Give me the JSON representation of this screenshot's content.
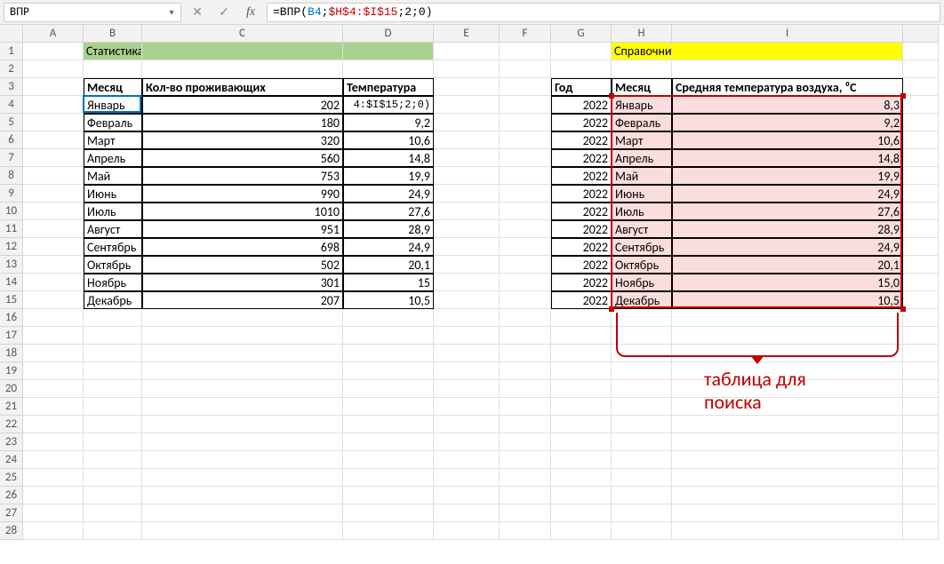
{
  "nameBox": "ВПР",
  "formula": {
    "prefix": "=ВПР(",
    "arg1": "B4",
    "sep1": ";",
    "arg2": "$H$4:$I$15",
    "sep2": ";",
    "arg3": "2",
    "sep3": ";",
    "arg4": "0",
    "suffix": ")"
  },
  "columns": [
    "A",
    "B",
    "C",
    "D",
    "E",
    "F",
    "G",
    "H",
    "I"
  ],
  "rows": [
    "1",
    "2",
    "3",
    "4",
    "5",
    "6",
    "7",
    "8",
    "9",
    "10",
    "11",
    "12",
    "13",
    "14",
    "15",
    "16",
    "17",
    "18",
    "19",
    "20",
    "21",
    "22",
    "23",
    "24",
    "25",
    "26",
    "27",
    "28"
  ],
  "titles": {
    "left": "Статистика по месяцам",
    "right": "Справочник температуры"
  },
  "leftHeaders": {
    "b": "Месяц",
    "c": "Кол-во проживающих",
    "d": "Температура"
  },
  "rightHeaders": {
    "g": "Год",
    "h": "Месяц",
    "i": "Средняя температура воздуха, ⁰С"
  },
  "d4_editing": "4:$I$15;2;0)",
  "leftTable": [
    {
      "month": "Январь",
      "cnt": "202",
      "temp": ""
    },
    {
      "month": "Февраль",
      "cnt": "180",
      "temp": "9,2"
    },
    {
      "month": "Март",
      "cnt": "320",
      "temp": "10,6"
    },
    {
      "month": "Апрель",
      "cnt": "560",
      "temp": "14,8"
    },
    {
      "month": "Май",
      "cnt": "753",
      "temp": "19,9"
    },
    {
      "month": "Июнь",
      "cnt": "990",
      "temp": "24,9"
    },
    {
      "month": "Июль",
      "cnt": "1010",
      "temp": "27,6"
    },
    {
      "month": "Август",
      "cnt": "951",
      "temp": "28,9"
    },
    {
      "month": "Сентябрь",
      "cnt": "698",
      "temp": "24,9"
    },
    {
      "month": "Октябрь",
      "cnt": "502",
      "temp": "20,1"
    },
    {
      "month": "Ноябрь",
      "cnt": "301",
      "temp": "15"
    },
    {
      "month": "Декабрь",
      "cnt": "207",
      "temp": "10,5"
    }
  ],
  "rightTable": [
    {
      "year": "2022",
      "month": "Январь",
      "avg": "8,3"
    },
    {
      "year": "2022",
      "month": "Февраль",
      "avg": "9,2"
    },
    {
      "year": "2022",
      "month": "Март",
      "avg": "10,6"
    },
    {
      "year": "2022",
      "month": "Апрель",
      "avg": "14,8"
    },
    {
      "year": "2022",
      "month": "Май",
      "avg": "19,9"
    },
    {
      "year": "2022",
      "month": "Июнь",
      "avg": "24,9"
    },
    {
      "year": "2022",
      "month": "Июль",
      "avg": "27,6"
    },
    {
      "year": "2022",
      "month": "Август",
      "avg": "28,9"
    },
    {
      "year": "2022",
      "month": "Сентябрь",
      "avg": "24,9"
    },
    {
      "year": "2022",
      "month": "Октябрь",
      "avg": "20,1"
    },
    {
      "year": "2022",
      "month": "Ноябрь",
      "avg": "15,0"
    },
    {
      "year": "2022",
      "month": "Декабрь",
      "avg": "10,5"
    }
  ],
  "callout": {
    "line1": "таблица для",
    "line2": "поиска"
  },
  "icons": {
    "cancel": "✕",
    "enter": "✓",
    "fx": "fx",
    "dd": "▾"
  }
}
